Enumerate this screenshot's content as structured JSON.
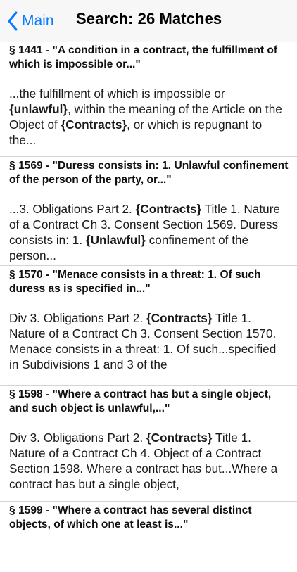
{
  "navbar": {
    "back_label": "Main",
    "title": "Search: 26 Matches"
  },
  "results": [
    {
      "title": "§ 1441 - \"A condition in a contract, the fulfillment of which is impossible or...\"",
      "snippet": [
        {
          "t": "...the fulfillment of which is impossible or "
        },
        {
          "t": "{unlawful}",
          "b": true
        },
        {
          "t": ", within the meaning of the Article on the Object of "
        },
        {
          "t": "{Contracts}",
          "b": true
        },
        {
          "t": ", or which is repugnant to the..."
        }
      ]
    },
    {
      "title": "§ 1569 - \"Duress consists in: 1. Unlawful confinement of the person of the party, or...\"",
      "snippet": [
        {
          "t": "...3. Obligations Part 2. "
        },
        {
          "t": "{Contracts}",
          "b": true
        },
        {
          "t": " Title 1. Nature of a Contract Ch 3. Consent Section 1569. Duress consists in: 1. "
        },
        {
          "t": "{Unlawful}",
          "b": true
        },
        {
          "t": " confinement of the person..."
        }
      ]
    },
    {
      "title": "§ 1570 - \"Menace consists in a threat: 1. Of such duress as is specified in...\"",
      "snippet": [
        {
          "t": "Div 3. Obligations Part 2. "
        },
        {
          "t": "{Contracts}",
          "b": true
        },
        {
          "t": " Title 1. Nature of a Contract Ch 3. Consent Section 1570. Menace consists in a threat: 1. Of such...specified in Subdivisions 1 and 3 of the"
        }
      ]
    },
    {
      "title": "§ 1598 - \"Where a contract has but a single object, and such object is unlawful,...\"",
      "snippet": [
        {
          "t": "Div 3. Obligations Part 2. "
        },
        {
          "t": "{Contracts}",
          "b": true
        },
        {
          "t": " Title 1. Nature of a Contract Ch 4. Object of a Contract Section 1598. Where a contract has but...Where a contract has but a single object,"
        }
      ]
    },
    {
      "title": "§ 1599 - \"Where a contract has several distinct objects, of which one at least is...\"",
      "snippet": []
    }
  ]
}
